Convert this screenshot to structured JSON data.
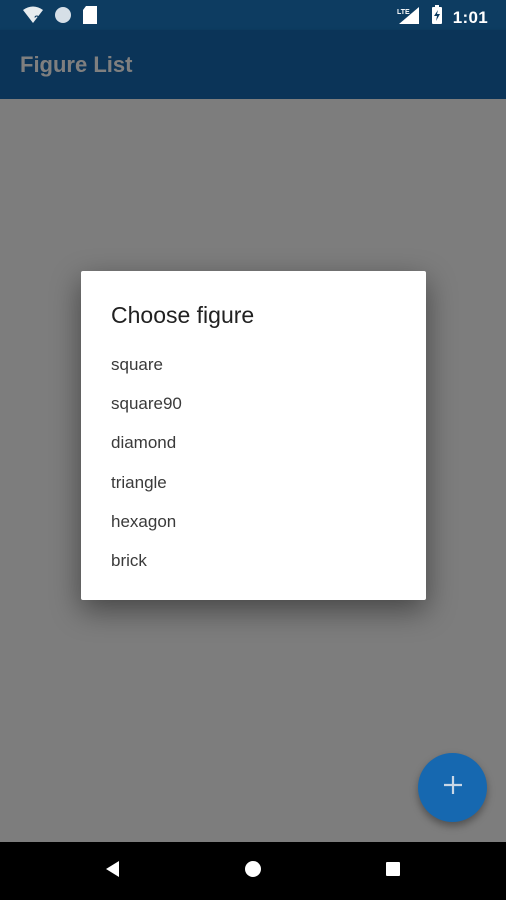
{
  "status_bar": {
    "time": "1:01",
    "icons": [
      "wifi-unknown-icon",
      "circle-icon",
      "sd-card-icon",
      "lte-signal-icon",
      "battery-charging-icon"
    ]
  },
  "app_bar": {
    "title": "Figure List"
  },
  "dialog": {
    "title": "Choose figure",
    "options": [
      "square",
      "square90",
      "diamond",
      "triangle",
      "hexagon",
      "brick"
    ]
  },
  "fab": {
    "icon": "plus-icon"
  },
  "nav_bar": {
    "buttons": [
      "back-icon",
      "home-icon",
      "recents-icon"
    ]
  },
  "colors": {
    "status_bar": "#0d3c61",
    "app_bar": "#1668b0",
    "accent": "#1668b0",
    "scrim": "rgba(0,0,0,0.5)"
  }
}
